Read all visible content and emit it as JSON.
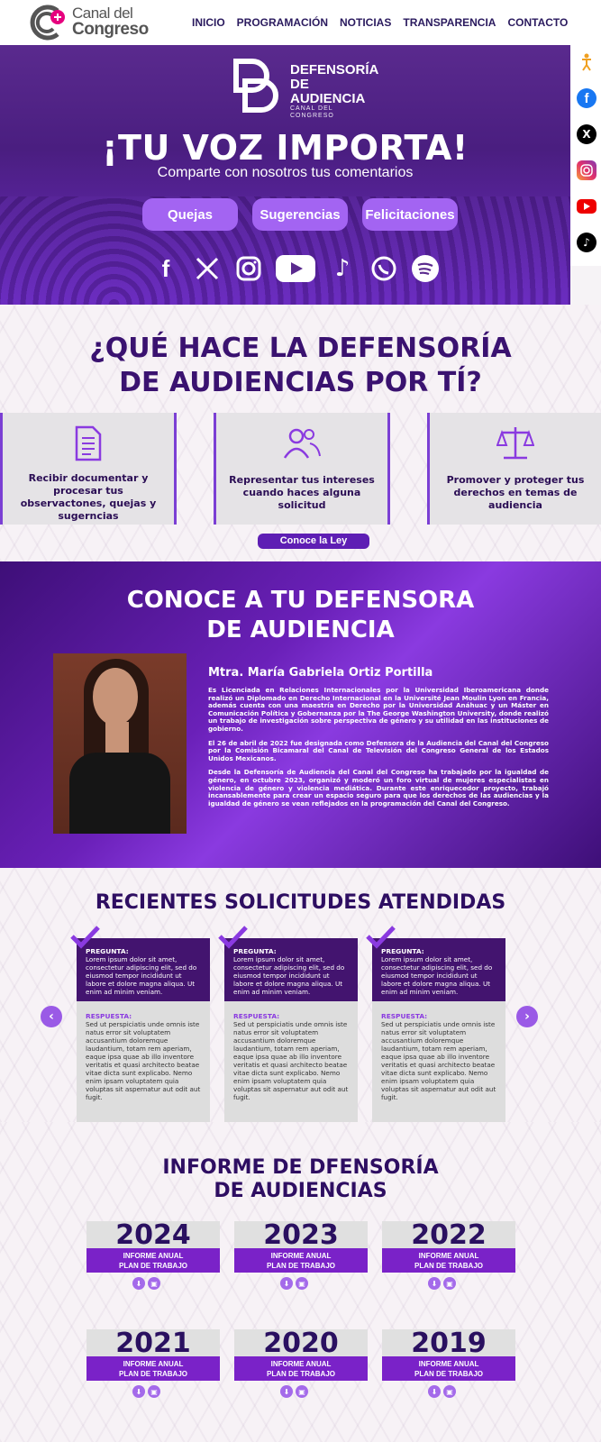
{
  "header": {
    "logo": {
      "line1": "Canal del",
      "line2": "Congreso"
    },
    "nav": [
      "INICIO",
      "PROGRAMACIÓN",
      "NOTICIAS",
      "TRANSPARENCIA",
      "CONTACTO"
    ]
  },
  "side_social": [
    "accessibility-icon",
    "facebook-icon",
    "x-icon",
    "instagram-icon",
    "youtube-icon",
    "tiktok-icon"
  ],
  "hero": {
    "brand": {
      "line1": "DEFENSORÍA",
      "line2": "DE AUDIENCIA",
      "line3": "CANAL DEL CONGRESO"
    },
    "title": "¡TU VOZ IMPORTA!",
    "subtitle": "Comparte con nosotros tus comentarios",
    "buttons": [
      "Quejas",
      "Sugerencias",
      "Felicitaciones"
    ],
    "social": [
      "facebook-icon",
      "x-icon",
      "instagram-icon",
      "youtube-icon",
      "tiktok-icon",
      "whatsapp-icon",
      "spotify-icon"
    ]
  },
  "what": {
    "title_line1": "¿QUÉ HACE LA DEFENSORÍA",
    "title_line2": "DE AUDIENCIAS POR TÍ?",
    "cards": [
      {
        "icon": "document-icon",
        "text": "Recibir documentar y procesar tus observactones, quejas y sugerncias"
      },
      {
        "icon": "people-icon",
        "text": "Representar tus intereses cuando haces alguna solicitud"
      },
      {
        "icon": "scale-icon",
        "text": "Promover y proteger tus derechos en temas de audiencia"
      }
    ],
    "law_button": "Conoce la Ley"
  },
  "defensora": {
    "title_line1": "CONOCE A TU DEFENSORA",
    "title_line2": "DE AUDIENCIA",
    "name": "Mtra. María Gabriela Ortiz Portilla",
    "bio": [
      "Es Licenciada en Relaciones Internacionales por la Universidad Iberoamericana donde realizó un Diplomado en Derecho Internacional en la Université Jean Moulin Lyon en Francia, además cuenta con una maestría en Derecho por la Universidad Anáhuac y un Máster en Comunicación Política y Gobernanza por la The George Washington University, donde realizó un trabajo de investigación sobre perspectiva de género y su utilidad en las instituciones de gobierno.",
      "El 26 de abril de 2022 fue designada como Defensora de la Audiencia del Canal del Congreso por la Comisión Bicamaral del Canal de Televisión del Congreso General de los Estados Unidos Mexicanos.",
      "Desde la Defensoría de Audiencia del Canal del Congreso ha trabajado por la igualdad de género, en octubre 2023, organizó y moderó un foro virtual de mujeres especialistas en violencia de género y violencia mediática. Durante este enriquecedor proyecto, trabajó incansablemente para crear un espacio seguro para que los derechos de las audiencias y la igualdad de género se vean reflejados en la programación del Canal del Congreso."
    ]
  },
  "requests": {
    "title": "RECIENTES SOLICITUDES ATENDIDAS",
    "items": [
      {
        "q_label": "PREGUNTA:",
        "q": "Lorem ipsum dolor sit amet, consectetur adipiscing elit, sed do eiusmod tempor incididunt ut labore et dolore magna aliqua. Ut enim ad minim veniam.",
        "r_label": "RESPUESTA:",
        "r": "Sed ut perspiciatis unde omnis iste natus error sit voluptatem accusantium doloremque laudantium, totam rem aperiam, eaque ipsa quae ab illo inventore veritatis et quasi architecto beatae vitae dicta sunt explicabo. Nemo enim ipsam voluptatem quia voluptas sit aspernatur aut odit aut fugit."
      },
      {
        "q_label": "PREGUNTA:",
        "q": "Lorem ipsum dolor sit amet, consectetur adipiscing elit, sed do eiusmod tempor incididunt ut labore et dolore magna aliqua. Ut enim ad minim veniam.",
        "r_label": "RESPUESTA:",
        "r": "Sed ut perspiciatis unde omnis iste natus error sit voluptatem accusantium doloremque laudantium, totam rem aperiam, eaque ipsa quae ab illo inventore veritatis et quasi architecto beatae vitae dicta sunt explicabo. Nemo enim ipsam voluptatem quia voluptas sit aspernatur aut odit aut fugit."
      },
      {
        "q_label": "PREGUNTA:",
        "q": "Lorem ipsum dolor sit amet, consectetur adipiscing elit, sed do eiusmod tempor incididunt ut labore et dolore magna aliqua. Ut enim ad minim veniam.",
        "r_label": "RESPUESTA:",
        "r": "Sed ut perspiciatis unde omnis iste natus error sit voluptatem accusantium doloremque laudantium, totam rem aperiam, eaque ipsa quae ab illo inventore veritatis et quasi architecto beatae vitae dicta sunt explicabo. Nemo enim ipsam voluptatem quia voluptas sit aspernatur aut odit aut fugit."
      }
    ],
    "prev": "‹",
    "next": "›"
  },
  "reports": {
    "title_line1": "INFORME DE DFENSORÍA",
    "title_line2": "DE AUDIENCIAS",
    "years": [
      {
        "year": "2024",
        "l1": "INFORME ANUAL",
        "l2": "PLAN DE TRABAJO"
      },
      {
        "year": "2023",
        "l1": "INFORME ANUAL",
        "l2": "PLAN DE TRABAJO"
      },
      {
        "year": "2022",
        "l1": "INFORME ANUAL",
        "l2": "PLAN DE TRABAJO"
      },
      {
        "year": "2021",
        "l1": "INFORME ANUAL",
        "l2": "PLAN DE TRABAJO"
      },
      {
        "year": "2020",
        "l1": "INFORME ANUAL",
        "l2": "PLAN DE TRABAJO"
      },
      {
        "year": "2019",
        "l1": "INFORME ANUAL",
        "l2": "PLAN DE TRABAJO"
      }
    ]
  },
  "colors": {
    "primary": "#5e1eb4",
    "accent": "#a364f2",
    "dark": "#2e0e62"
  }
}
